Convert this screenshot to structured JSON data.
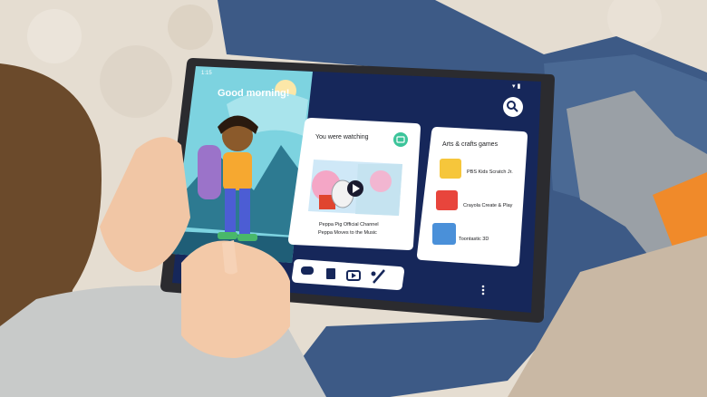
{
  "status_bar": {
    "time": "1:15"
  },
  "greeting": "Good morning!",
  "watching_card": {
    "title": "You were watching",
    "channel": "Peppa Pig Official Channel",
    "episode": "Peppa Moves to the Music"
  },
  "games_card": {
    "title": "Arts & crafts games",
    "items": [
      {
        "label": "PBS Kids Scratch Jr."
      },
      {
        "label": "Crayola Create & Play"
      },
      {
        "label": "Toontastic 3D"
      }
    ]
  },
  "nav": {
    "icons": [
      "games-icon",
      "books-icon",
      "videos-icon",
      "create-icon"
    ]
  },
  "colors": {
    "screen_bg": "#16275a",
    "sky": "#7dd3e0",
    "card_bg": "#ffffff",
    "play_button": "#1a1a2e",
    "peppa_pink": "#f4a6c6",
    "bezel": "#2b2b2f"
  }
}
